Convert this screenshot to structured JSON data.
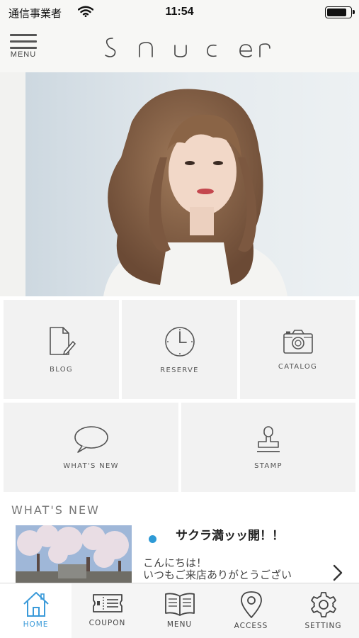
{
  "status_bar": {
    "carrier": "通信事業者",
    "time": "11:54",
    "battery_level": 0.85
  },
  "header": {
    "menu_label": "MENU",
    "logo_text": "saucer"
  },
  "carousel": {
    "page_count": 15,
    "active_index": 0
  },
  "tiles": [
    {
      "label": "BLOG",
      "icon": "document-pen-icon"
    },
    {
      "label": "RESERVE",
      "icon": "clock-icon"
    },
    {
      "label": "CATALOG",
      "icon": "camera-icon"
    },
    {
      "label": "WHAT'S NEW",
      "icon": "speech-bubble-icon"
    },
    {
      "label": "STAMP",
      "icon": "stamp-icon"
    }
  ],
  "whats_new": {
    "heading": "WHAT'S NEW",
    "items": [
      {
        "title": "サクラ満ッッ開！！",
        "body": "こんにちは！\nいつもご来店ありがとうござい",
        "unread_color": "#2e9ad6"
      }
    ]
  },
  "tabbar": {
    "active": "home",
    "accent_color": "#3a9ad9",
    "items": [
      {
        "id": "home",
        "label": "HOME",
        "icon": "house-icon"
      },
      {
        "id": "coupon",
        "label": "COUPON",
        "icon": "ticket-icon"
      },
      {
        "id": "menu",
        "label": "MENU",
        "icon": "open-book-icon"
      },
      {
        "id": "access",
        "label": "ACCESS",
        "icon": "map-pin-icon"
      },
      {
        "id": "setting",
        "label": "SETTING",
        "icon": "gear-icon"
      }
    ]
  }
}
